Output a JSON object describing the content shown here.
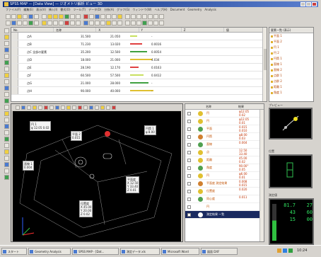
{
  "window": {
    "title": "SPSS MAP — [Data View] — ジオメトリ解析 ビュー 3D"
  },
  "menubar": [
    "ファイル(F)",
    "編集(E)",
    "表示(V)",
    "挿入(I)",
    "書式(O)",
    "ツール(T)",
    "データ(D)",
    "分析(A)",
    "グラフ(G)",
    "ウィンドウ(W)",
    "ヘルプ(H)",
    "Document",
    "Geometry",
    "Analysis"
  ],
  "table": {
    "headers": [
      "No.",
      "名称",
      "X",
      "Y",
      "Z",
      "値"
    ],
    "rows": [
      {
        "name": "点A",
        "x": "31.500",
        "y": "21.050",
        "v": "-"
      },
      {
        "name": "点B",
        "x": "71.230",
        "y": "13.020",
        "v": "0.0016"
      },
      {
        "name": "点C 全部の要素",
        "x": "35.200",
        "y": "12.500",
        "v": "0.0054"
      },
      {
        "name": "点D",
        "x": "18.000",
        "y": "21.000",
        "v": "4.034"
      },
      {
        "name": "点E",
        "x": "28.190",
        "y": "12.170",
        "v": "0.0163"
      },
      {
        "name": "点F",
        "x": "60.500",
        "y": "57.500",
        "v": "0.0412"
      },
      {
        "name": "点G",
        "x": "21.000",
        "y": "28.000",
        "v": "-"
      },
      {
        "name": "点H",
        "x": "90.000",
        "y": "40.000",
        "v": "-"
      }
    ]
  },
  "tree": {
    "header": "要素一覧 (表示)",
    "nodes": [
      "平面 1",
      "平面 2",
      "円 1",
      "円 2",
      "円筒 1",
      "直線 1",
      "直線 2",
      "点群 1",
      "点群 2",
      "距離 1",
      "角度 1"
    ]
  },
  "viewport": {
    "callouts": [
      {
        "lines": [
          "円 1",
          "φ 12.05  0.02"
        ]
      },
      {
        "lines": [
          "平面 2",
          "0.015"
        ]
      },
      {
        "lines": [
          "円筒 1",
          "φ 8.00"
        ]
      },
      {
        "lines": [
          "直線 1",
          "0.004"
        ]
      },
      {
        "lines": [
          "平面度",
          "X  12.50",
          "Y  33.40",
          "Z   0.01"
        ]
      },
      {
        "lines": [
          "位置度",
          "X  45.00",
          "Y  20.00",
          "Z   0.02"
        ]
      }
    ]
  },
  "list": {
    "headers": [
      "",
      "名称",
      "結果"
    ],
    "items": [
      {
        "name": "円",
        "value": "φ12.05\n0.02",
        "color": "#e0c030"
      },
      {
        "name": "円",
        "value": "φ12.05\n0.01",
        "color": "#e0c030"
      },
      {
        "name": "平面",
        "value": "0.015\n0.010",
        "color": "#50a050"
      },
      {
        "name": "円筒",
        "value": "φ8.00\n0.03",
        "color": "#d08030"
      },
      {
        "name": "直線",
        "value": "0.004",
        "color": "#50a050"
      },
      {
        "name": "点",
        "value": "12.50\n33.40",
        "color": "#e0c030"
      },
      {
        "name": "距離",
        "value": "45.00\n0.02",
        "color": "#e0c030"
      },
      {
        "name": "角度",
        "value": "90.00°\n0.05",
        "color": "#50a050"
      },
      {
        "name": "円",
        "value": "φ6.00\n0.01",
        "color": "#e0c030"
      },
      {
        "name": "平面度 測定結果",
        "value": "0.008\n0.015",
        "color": "#d08030"
      },
      {
        "name": "位置度",
        "value": "0.020",
        "color": "#e0c030"
      },
      {
        "name": "同心度",
        "value": "0.011",
        "color": "#50a050"
      },
      {
        "name": "円",
        "value": "",
        "color": "#ffffff"
      },
      {
        "name": "測定結果 一覧",
        "value": "",
        "color": "#ffffff"
      }
    ]
  },
  "right": {
    "preview1_label": "プレビュー",
    "preview2_label": "位置",
    "preview3_label": "測定値",
    "digits": [
      "81.7",
      "27",
      "43",
      "60",
      "15",
      "00"
    ]
  },
  "taskbar": {
    "tasks": [
      "スタート",
      "Geometry Analysis",
      "SPSS MAP - [Dat...",
      "測定データ.xls",
      "Microsoft Word",
      "図面 DXF"
    ],
    "clock": "10:24"
  }
}
